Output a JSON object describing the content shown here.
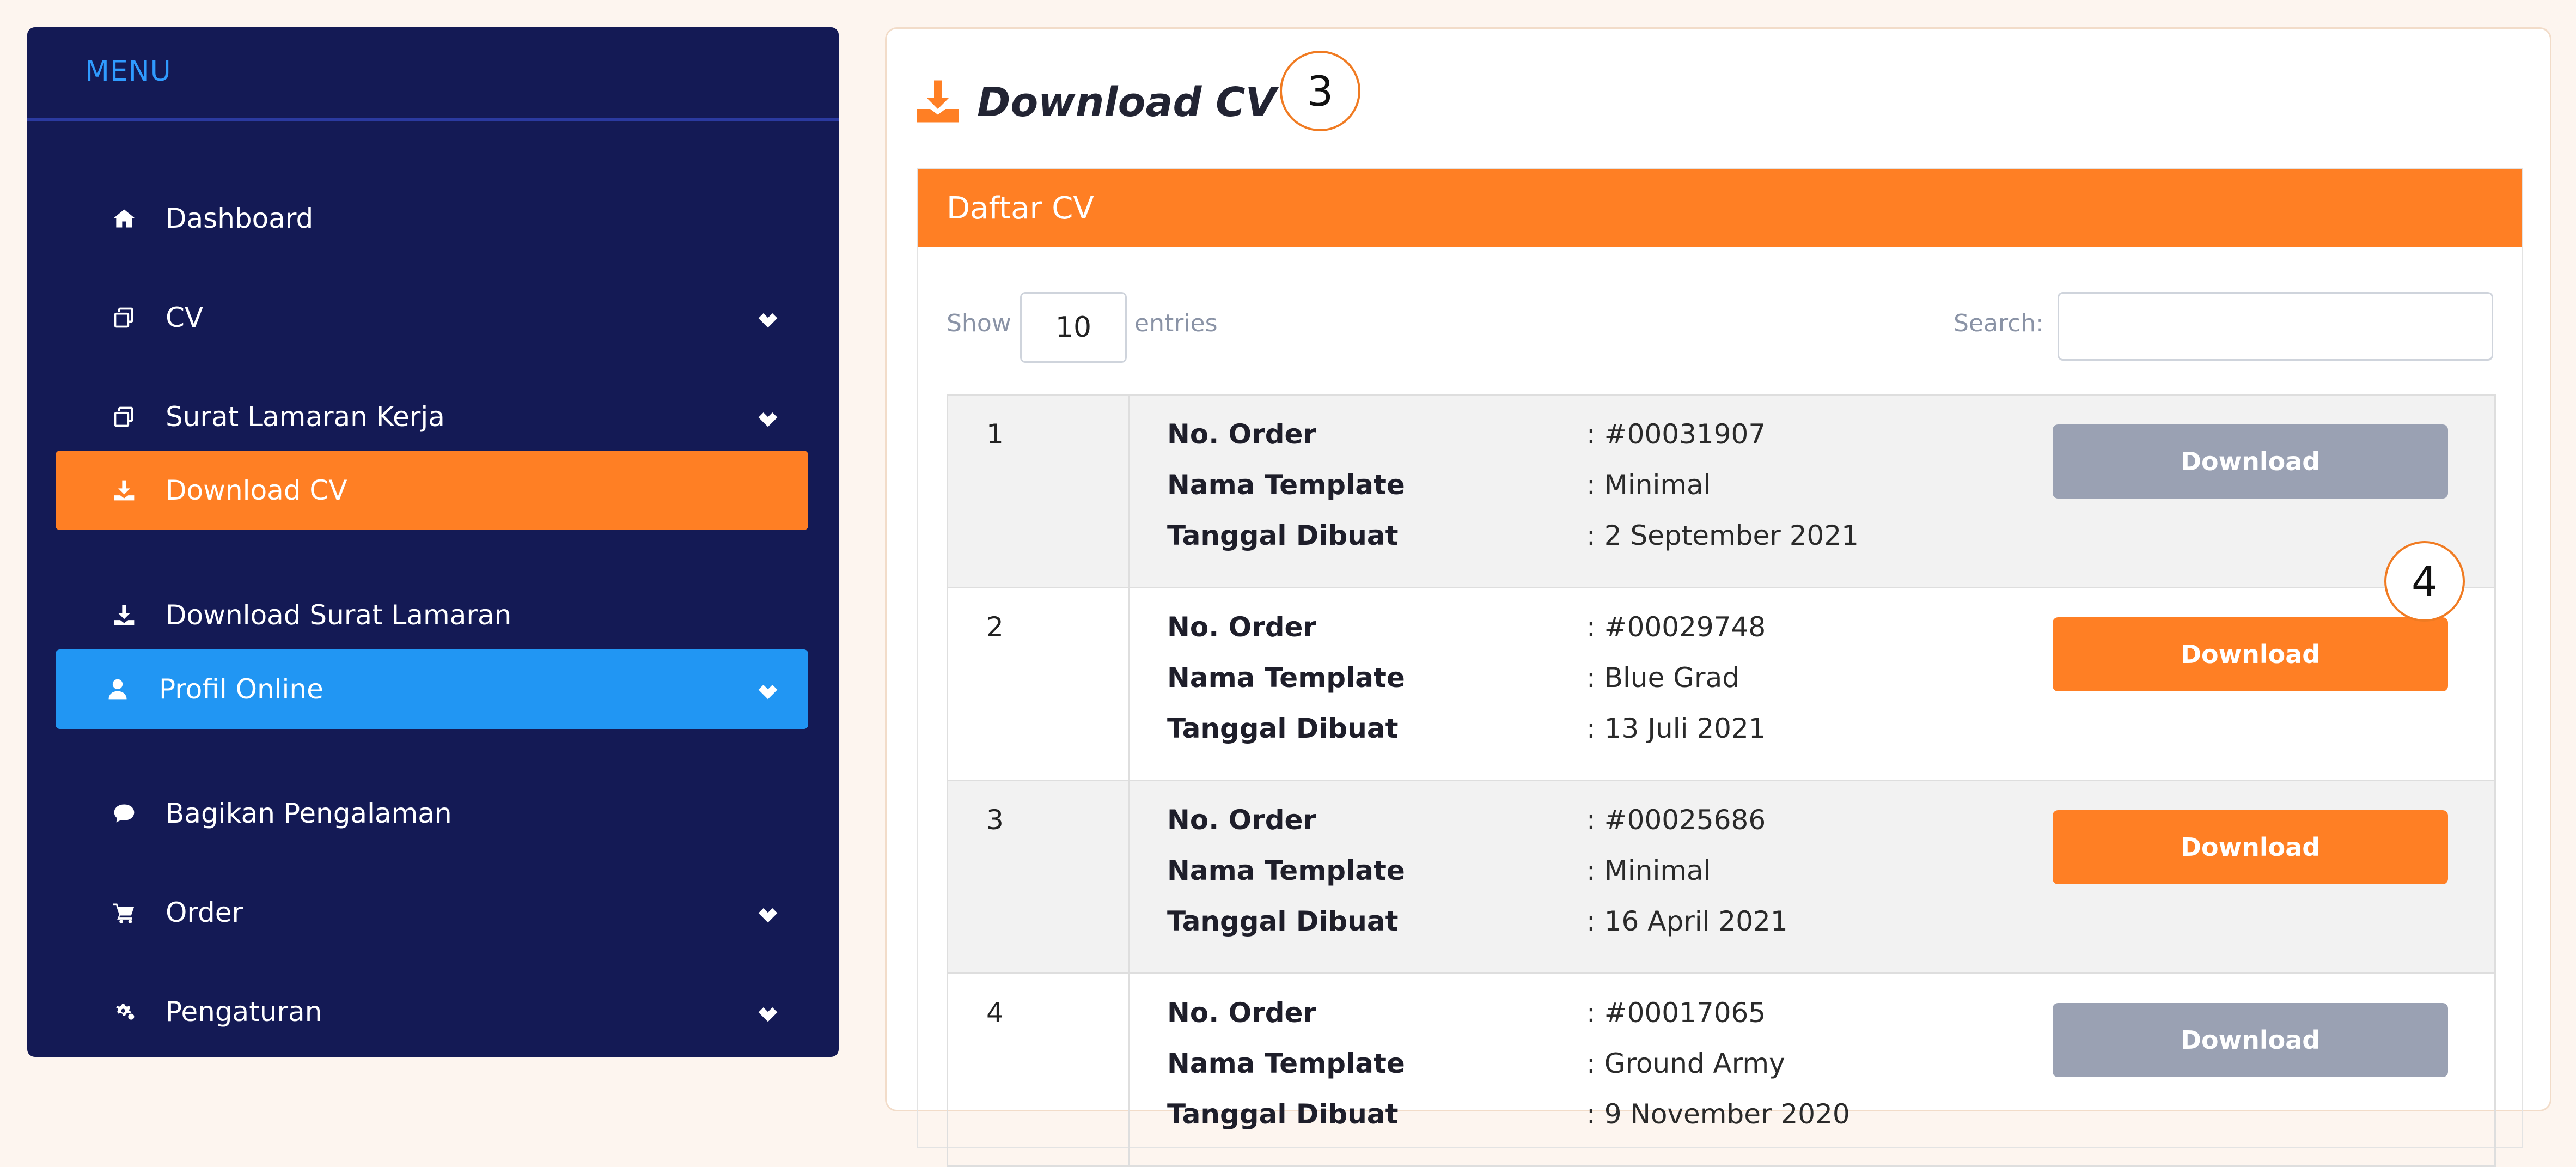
{
  "sidebar": {
    "menu_title": "MENU",
    "items": [
      {
        "label": "Dashboard",
        "icon": "home-icon",
        "dropdown": false,
        "state": "normal"
      },
      {
        "label": "CV",
        "icon": "copy-icon",
        "dropdown": true,
        "state": "normal"
      },
      {
        "label": "Surat Lamaran Kerja",
        "icon": "copy-icon",
        "dropdown": true,
        "state": "normal"
      },
      {
        "label": "Download CV",
        "icon": "download-icon",
        "dropdown": false,
        "state": "active"
      },
      {
        "label": "Download Surat Lamaran",
        "icon": "download-icon",
        "dropdown": false,
        "state": "normal"
      },
      {
        "label": "Profil Online",
        "icon": "user-icon",
        "dropdown": true,
        "state": "highlighted"
      },
      {
        "label": "Bagikan Pengalaman",
        "icon": "comment-icon",
        "dropdown": false,
        "state": "normal"
      },
      {
        "label": "Order",
        "icon": "cart-icon",
        "dropdown": true,
        "state": "normal"
      },
      {
        "label": "Pengaturan",
        "icon": "gears-icon",
        "dropdown": true,
        "state": "normal"
      }
    ]
  },
  "header": {
    "title": "Download CV",
    "step_badge": "3"
  },
  "panel": {
    "title": "Daftar CV",
    "show_label": "Show",
    "entries_value": "10",
    "entries_label": "entries",
    "search_label": "Search:",
    "search_value": ""
  },
  "field_labels": {
    "order": "No. Order",
    "template": "Nama Template",
    "date": "Tanggal Dibuat"
  },
  "rows": [
    {
      "no": "1",
      "order": ": #00031907",
      "template": ": Minimal",
      "date": ": 2 September 2021",
      "button": "Download",
      "button_state": "disabled"
    },
    {
      "no": "2",
      "order": ": #00029748",
      "template": ": Blue Grad",
      "date": ": 13 Juli 2021",
      "button": "Download",
      "button_state": "enabled"
    },
    {
      "no": "3",
      "order": ": #00025686",
      "template": ": Minimal",
      "date": ": 16 April 2021",
      "button": "Download",
      "button_state": "enabled"
    },
    {
      "no": "4",
      "order": ": #00017065",
      "template": ": Ground Army",
      "date": ": 9 November 2020",
      "button": "Download",
      "button_state": "disabled"
    }
  ],
  "step_badge_2": "4",
  "colors": {
    "sidebar_bg": "#141a55",
    "accent_orange": "#ff7f24",
    "accent_blue": "#2196f3",
    "menu_title": "#2f9bff",
    "button_disabled": "#9aa1b3"
  }
}
